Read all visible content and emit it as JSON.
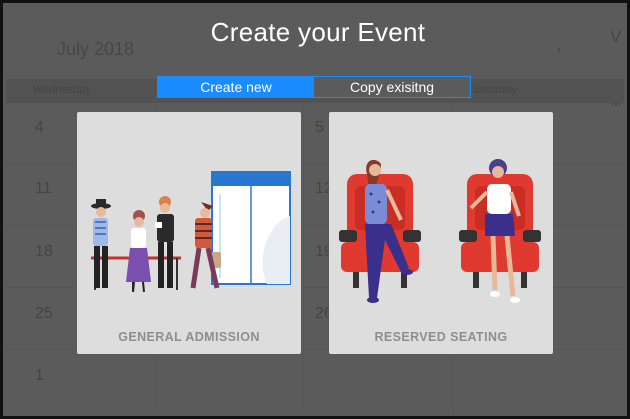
{
  "background": {
    "month_label": "July 2018",
    "day_headers": [
      "Wednesday",
      "",
      "",
      "Saturday"
    ],
    "dates": [
      "4",
      "11",
      "18",
      "25",
      "1",
      "5",
      "12",
      "19",
      "26"
    ],
    "right_letter": "V",
    "right_letter_small": "M"
  },
  "dialog": {
    "title": "Create your Event",
    "toggle": {
      "create_new": "Create new",
      "copy_existing": "Copy exisitng",
      "selected": "create_new"
    },
    "cards": {
      "general_admission": "GENERAL ADMISSION",
      "reserved_seating": "RESERVED SEATING"
    }
  },
  "colors": {
    "accent": "#1a8cff",
    "overlay": "#5b5b5b",
    "card_bg": "#dddddd",
    "card_label": "#8e8e8e",
    "seat_red": "#e0392f"
  }
}
